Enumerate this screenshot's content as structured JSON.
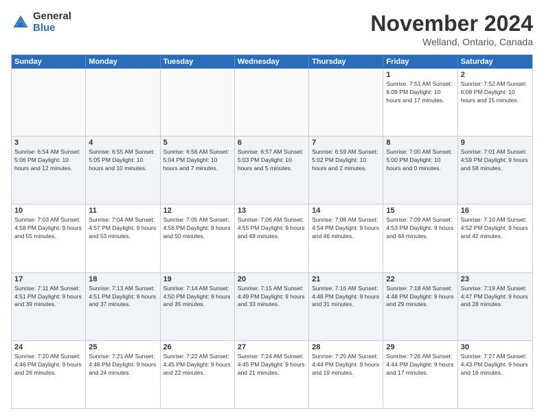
{
  "logo": {
    "general": "General",
    "blue": "Blue"
  },
  "title": "November 2024",
  "location": "Welland, Ontario, Canada",
  "header": {
    "days": [
      "Sunday",
      "Monday",
      "Tuesday",
      "Wednesday",
      "Thursday",
      "Friday",
      "Saturday"
    ]
  },
  "weeks": [
    [
      {
        "day": "",
        "info": ""
      },
      {
        "day": "",
        "info": ""
      },
      {
        "day": "",
        "info": ""
      },
      {
        "day": "",
        "info": ""
      },
      {
        "day": "",
        "info": ""
      },
      {
        "day": "1",
        "info": "Sunrise: 7:51 AM\nSunset: 6:09 PM\nDaylight: 10 hours and 17 minutes."
      },
      {
        "day": "2",
        "info": "Sunrise: 7:52 AM\nSunset: 6:08 PM\nDaylight: 10 hours and 15 minutes."
      }
    ],
    [
      {
        "day": "3",
        "info": "Sunrise: 6:54 AM\nSunset: 5:06 PM\nDaylight: 10 hours and 12 minutes."
      },
      {
        "day": "4",
        "info": "Sunrise: 6:55 AM\nSunset: 5:05 PM\nDaylight: 10 hours and 10 minutes."
      },
      {
        "day": "5",
        "info": "Sunrise: 6:56 AM\nSunset: 5:04 PM\nDaylight: 10 hours and 7 minutes."
      },
      {
        "day": "6",
        "info": "Sunrise: 6:57 AM\nSunset: 5:03 PM\nDaylight: 10 hours and 5 minutes."
      },
      {
        "day": "7",
        "info": "Sunrise: 6:59 AM\nSunset: 5:02 PM\nDaylight: 10 hours and 2 minutes."
      },
      {
        "day": "8",
        "info": "Sunrise: 7:00 AM\nSunset: 5:00 PM\nDaylight: 10 hours and 0 minutes."
      },
      {
        "day": "9",
        "info": "Sunrise: 7:01 AM\nSunset: 4:59 PM\nDaylight: 9 hours and 58 minutes."
      }
    ],
    [
      {
        "day": "10",
        "info": "Sunrise: 7:03 AM\nSunset: 4:58 PM\nDaylight: 9 hours and 55 minutes."
      },
      {
        "day": "11",
        "info": "Sunrise: 7:04 AM\nSunset: 4:57 PM\nDaylight: 9 hours and 53 minutes."
      },
      {
        "day": "12",
        "info": "Sunrise: 7:05 AM\nSunset: 4:56 PM\nDaylight: 9 hours and 50 minutes."
      },
      {
        "day": "13",
        "info": "Sunrise: 7:06 AM\nSunset: 4:55 PM\nDaylight: 9 hours and 48 minutes."
      },
      {
        "day": "14",
        "info": "Sunrise: 7:08 AM\nSunset: 4:54 PM\nDaylight: 9 hours and 46 minutes."
      },
      {
        "day": "15",
        "info": "Sunrise: 7:09 AM\nSunset: 4:53 PM\nDaylight: 9 hours and 44 minutes."
      },
      {
        "day": "16",
        "info": "Sunrise: 7:10 AM\nSunset: 4:52 PM\nDaylight: 9 hours and 42 minutes."
      }
    ],
    [
      {
        "day": "17",
        "info": "Sunrise: 7:11 AM\nSunset: 4:51 PM\nDaylight: 9 hours and 39 minutes."
      },
      {
        "day": "18",
        "info": "Sunrise: 7:13 AM\nSunset: 4:51 PM\nDaylight: 9 hours and 37 minutes."
      },
      {
        "day": "19",
        "info": "Sunrise: 7:14 AM\nSunset: 4:50 PM\nDaylight: 9 hours and 35 minutes."
      },
      {
        "day": "20",
        "info": "Sunrise: 7:15 AM\nSunset: 4:49 PM\nDaylight: 9 hours and 33 minutes."
      },
      {
        "day": "21",
        "info": "Sunrise: 7:16 AM\nSunset: 4:48 PM\nDaylight: 9 hours and 31 minutes."
      },
      {
        "day": "22",
        "info": "Sunrise: 7:18 AM\nSunset: 4:48 PM\nDaylight: 9 hours and 29 minutes."
      },
      {
        "day": "23",
        "info": "Sunrise: 7:19 AM\nSunset: 4:47 PM\nDaylight: 9 hours and 28 minutes."
      }
    ],
    [
      {
        "day": "24",
        "info": "Sunrise: 7:20 AM\nSunset: 4:46 PM\nDaylight: 9 hours and 26 minutes."
      },
      {
        "day": "25",
        "info": "Sunrise: 7:21 AM\nSunset: 4:46 PM\nDaylight: 9 hours and 24 minutes."
      },
      {
        "day": "26",
        "info": "Sunrise: 7:22 AM\nSunset: 4:45 PM\nDaylight: 9 hours and 22 minutes."
      },
      {
        "day": "27",
        "info": "Sunrise: 7:24 AM\nSunset: 4:45 PM\nDaylight: 9 hours and 21 minutes."
      },
      {
        "day": "28",
        "info": "Sunrise: 7:25 AM\nSunset: 4:44 PM\nDaylight: 9 hours and 19 minutes."
      },
      {
        "day": "29",
        "info": "Sunrise: 7:26 AM\nSunset: 4:44 PM\nDaylight: 9 hours and 17 minutes."
      },
      {
        "day": "30",
        "info": "Sunrise: 7:27 AM\nSunset: 4:43 PM\nDaylight: 9 hours and 16 minutes."
      }
    ]
  ]
}
